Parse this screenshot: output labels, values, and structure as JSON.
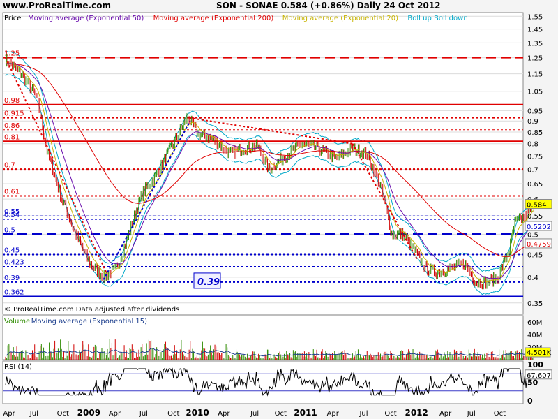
{
  "header": {
    "site": "www.ProRealTime.com",
    "quote": "SON - SONAE   0.584 (+0.86%)   Daily  24 Oct 2012"
  },
  "price_panel": {
    "legend": [
      {
        "text": "Price",
        "color": "#000000"
      },
      {
        "text": "Moving average (Exponential 50)",
        "color": "#6a0dad"
      },
      {
        "text": "Moving average (Exponential 200)",
        "color": "#e00000"
      },
      {
        "text": "Moving average (Exponential 20)",
        "color": "#c8b400"
      },
      {
        "text": "Boll up Boll down",
        "color": "#00a8c8"
      }
    ],
    "footer": "© ProRealTime.com  Data adjusted after dividends",
    "box_label": "0.39"
  },
  "volume_panel": {
    "legend": [
      {
        "text": "Volume",
        "color": "#2e8b00"
      },
      {
        "text": "Moving average (Exponential 15)",
        "color": "#1a3c8c"
      }
    ],
    "axis_labels": [
      "60M",
      "40M",
      "20M"
    ],
    "last_value": "4,501K"
  },
  "rsi_panel": {
    "legend": "RSI (14)",
    "axis_labels": [
      "100",
      "50",
      "0"
    ],
    "last_value": "67.607"
  },
  "x_axis_labels": [
    "Apr",
    "Jul",
    "Oct",
    "2009",
    "Apr",
    "Jul",
    "Oct",
    "2010",
    "Apr",
    "Jul",
    "Oct",
    "2011",
    "Apr",
    "Jul",
    "Oct",
    "2012",
    "Apr",
    "Jul",
    "Oct"
  ],
  "colors": {
    "price_up": "#2e8b00",
    "price_down": "#d00000",
    "ema50": "#6a0dad",
    "ema200": "#e00000",
    "ema20": "#c8b400",
    "bollinger": "#00a8c8",
    "support": "#0000cc",
    "resistance": "#e00000",
    "background": "#ffffff"
  },
  "chart_data": {
    "type": "line",
    "title": "SON - SONAE",
    "ylim": [
      0.33,
      1.58
    ],
    "y_scale": "log",
    "y_ticks": [
      "1.55",
      "1.45",
      "1.35",
      "1.25",
      "1.15",
      "1.05",
      "0.95",
      "0.9",
      "0.85",
      "0.8",
      "0.75",
      "0.7",
      "0.65",
      "0.6",
      "0.55",
      "0.5",
      "0.45",
      "0.4",
      "0.35"
    ],
    "last_price": "0.584",
    "price_tags": [
      {
        "text": "0.584",
        "value": 0.584,
        "bg": "#ffff00",
        "fg": "#000000"
      },
      {
        "text": "0.5202",
        "value": 0.521,
        "bg": "#ffffff",
        "fg": "#0000cc"
      },
      {
        "text": "0.4759",
        "value": 0.476,
        "bg": "#ffffff",
        "fg": "#e00000"
      }
    ],
    "horizontal_levels": [
      {
        "label": "1.25",
        "value": 1.25,
        "color": "#e00000",
        "style": "dashed",
        "width": 2
      },
      {
        "label": "0.98",
        "value": 0.98,
        "color": "#e00000",
        "style": "solid",
        "width": 2
      },
      {
        "label": "0.915",
        "value": 0.915,
        "color": "#e00000",
        "style": "dotted",
        "width": 2
      },
      {
        "label": "0.86",
        "value": 0.86,
        "color": "#e00000",
        "style": "dotted",
        "width": 1
      },
      {
        "label": "0.81",
        "value": 0.81,
        "color": "#e00000",
        "style": "solid",
        "width": 2
      },
      {
        "label": "0.7",
        "value": 0.7,
        "color": "#e00000",
        "style": "dotted",
        "width": 3
      },
      {
        "label": "0.61",
        "value": 0.61,
        "color": "#e00000",
        "style": "dotted",
        "width": 2
      },
      {
        "label": "0.55",
        "value": 0.55,
        "color": "#0000cc",
        "style": "dotted",
        "width": 1
      },
      {
        "label": "0.54",
        "value": 0.54,
        "color": "#0000cc",
        "style": "dotted",
        "width": 1
      },
      {
        "label": "0.5",
        "value": 0.5,
        "color": "#0000cc",
        "style": "dashed",
        "width": 3
      },
      {
        "label": "0.45",
        "value": 0.45,
        "color": "#0000cc",
        "style": "dotted",
        "width": 2
      },
      {
        "label": "0.423",
        "value": 0.423,
        "color": "#0000cc",
        "style": "dotted",
        "width": 1
      },
      {
        "label": "0.39",
        "value": 0.39,
        "color": "#0000cc",
        "style": "dotted",
        "width": 2
      },
      {
        "label": "0.362",
        "value": 0.362,
        "color": "#0000cc",
        "style": "solid",
        "width": 2
      }
    ],
    "trendlines": [
      {
        "points": [
          [
            0,
            1.25
          ],
          [
            180,
            0.41
          ]
        ],
        "color": "#e00000"
      },
      {
        "points": [
          [
            175,
            0.395
          ],
          [
            330,
            0.9
          ]
        ],
        "color": "#0000cc"
      },
      {
        "points": [
          [
            328,
            0.915
          ],
          [
            620,
            0.8
          ]
        ],
        "color": "#e00000"
      },
      {
        "points": [
          [
            620,
            0.8
          ],
          [
            735,
            0.44
          ]
        ],
        "color": "#e00000"
      }
    ],
    "x_index_range": [
      0,
      880
    ],
    "x_tick_positions": [
      10,
      60,
      118,
      170,
      222,
      280,
      340,
      388,
      441,
      503,
      555,
      605,
      660,
      722,
      776,
      828,
      886,
      938,
      995
    ],
    "price_anchors": [
      [
        0,
        1.24
      ],
      [
        30,
        1.14
      ],
      [
        55,
        1.02
      ],
      [
        75,
        0.76
      ],
      [
        100,
        0.6
      ],
      [
        125,
        0.5
      ],
      [
        150,
        0.43
      ],
      [
        175,
        0.4
      ],
      [
        200,
        0.42
      ],
      [
        220,
        0.5
      ],
      [
        245,
        0.62
      ],
      [
        270,
        0.68
      ],
      [
        300,
        0.8
      ],
      [
        325,
        0.92
      ],
      [
        345,
        0.84
      ],
      [
        370,
        0.82
      ],
      [
        400,
        0.76
      ],
      [
        425,
        0.78
      ],
      [
        450,
        0.79
      ],
      [
        470,
        0.7
      ],
      [
        500,
        0.75
      ],
      [
        530,
        0.8
      ],
      [
        560,
        0.78
      ],
      [
        590,
        0.74
      ],
      [
        620,
        0.78
      ],
      [
        645,
        0.76
      ],
      [
        670,
        0.64
      ],
      [
        690,
        0.5
      ],
      [
        710,
        0.5
      ],
      [
        730,
        0.46
      ],
      [
        750,
        0.42
      ],
      [
        770,
        0.41
      ],
      [
        800,
        0.42
      ],
      [
        820,
        0.43
      ],
      [
        840,
        0.39
      ],
      [
        860,
        0.39
      ],
      [
        880,
        0.4
      ],
      [
        900,
        0.46
      ],
      [
        910,
        0.53
      ],
      [
        930,
        0.55
      ],
      [
        945,
        0.584
      ]
    ]
  }
}
